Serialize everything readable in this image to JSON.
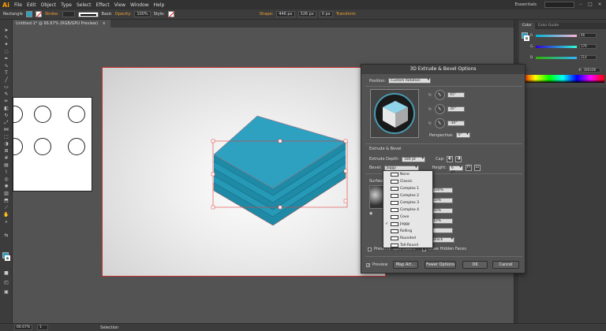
{
  "app": {
    "logo": "Ai",
    "menu": [
      "File",
      "Edit",
      "Object",
      "Type",
      "Select",
      "Effect",
      "View",
      "Window",
      "Help"
    ],
    "workspace": "Essentials",
    "window_controls": [
      "–",
      "□",
      "×"
    ]
  },
  "control_bar": {
    "selection_label": "Rectangle",
    "stroke_label": "Stroke:",
    "stroke_style": "Basic",
    "opacity_label": "Opacity:",
    "opacity_value": "100%",
    "style_label": "Style:",
    "shape_label": "Shape:",
    "w_value": "446 px",
    "h_value": "326 px",
    "corner_value": "0 px",
    "transform_label": "Transform"
  },
  "document": {
    "tab_title": "Untitled-1* @ 66.67% (RGB/GPU Preview)",
    "close_glyph": "×"
  },
  "status_bar": {
    "zoom": "66.67%",
    "artboard_index": "1",
    "status_text": "Selection"
  },
  "color_panel": {
    "tabs": [
      "Color",
      "Color Guide"
    ],
    "R": "46",
    "G": "179",
    "B": "214",
    "hex_label": "#",
    "hex": "2EB3D6",
    "colors": {
      "fill": "#2eb3d6",
      "accent": "#2ea0c0"
    }
  },
  "dialog": {
    "title": "3D Extrude & Bevel Options",
    "position_label": "Position:",
    "position_value": "Custom Rotation",
    "rot_x": "45°",
    "rot_y": "35°",
    "rot_z": "-30°",
    "perspective_label": "Perspective:",
    "perspective_value": "0°",
    "extrude_section": "Extrude & Bevel",
    "extrude_depth_label": "Extrude Depth:",
    "extrude_depth_value": "180 pt",
    "cap_label": "Cap:",
    "bevel_label": "Bevel:",
    "bevel_value": "Jaggy",
    "height_label": "Height:",
    "height_value": "6 pt",
    "surface_label": "Surface:",
    "surface_fields": [
      "100%",
      "50%",
      "60%",
      "10%"
    ],
    "shading_value": "Black",
    "preserve_spot": "Preserve Spot Colors",
    "draw_hidden": "Draw Hidden Faces",
    "preview_label": "Preview",
    "preview_checked": true,
    "buttons": {
      "map_art": "Map Art...",
      "fewer_options": "Fewer Options",
      "ok": "OK",
      "cancel": "Cancel"
    }
  },
  "bevel_menu": {
    "items": [
      "None",
      "Classic",
      "Complex 1",
      "Complex 2",
      "Complex 3",
      "Complex 4",
      "Cove",
      "Jaggy",
      "Rolling",
      "Rounded",
      "Tall-Round"
    ],
    "selected": "Jaggy"
  }
}
